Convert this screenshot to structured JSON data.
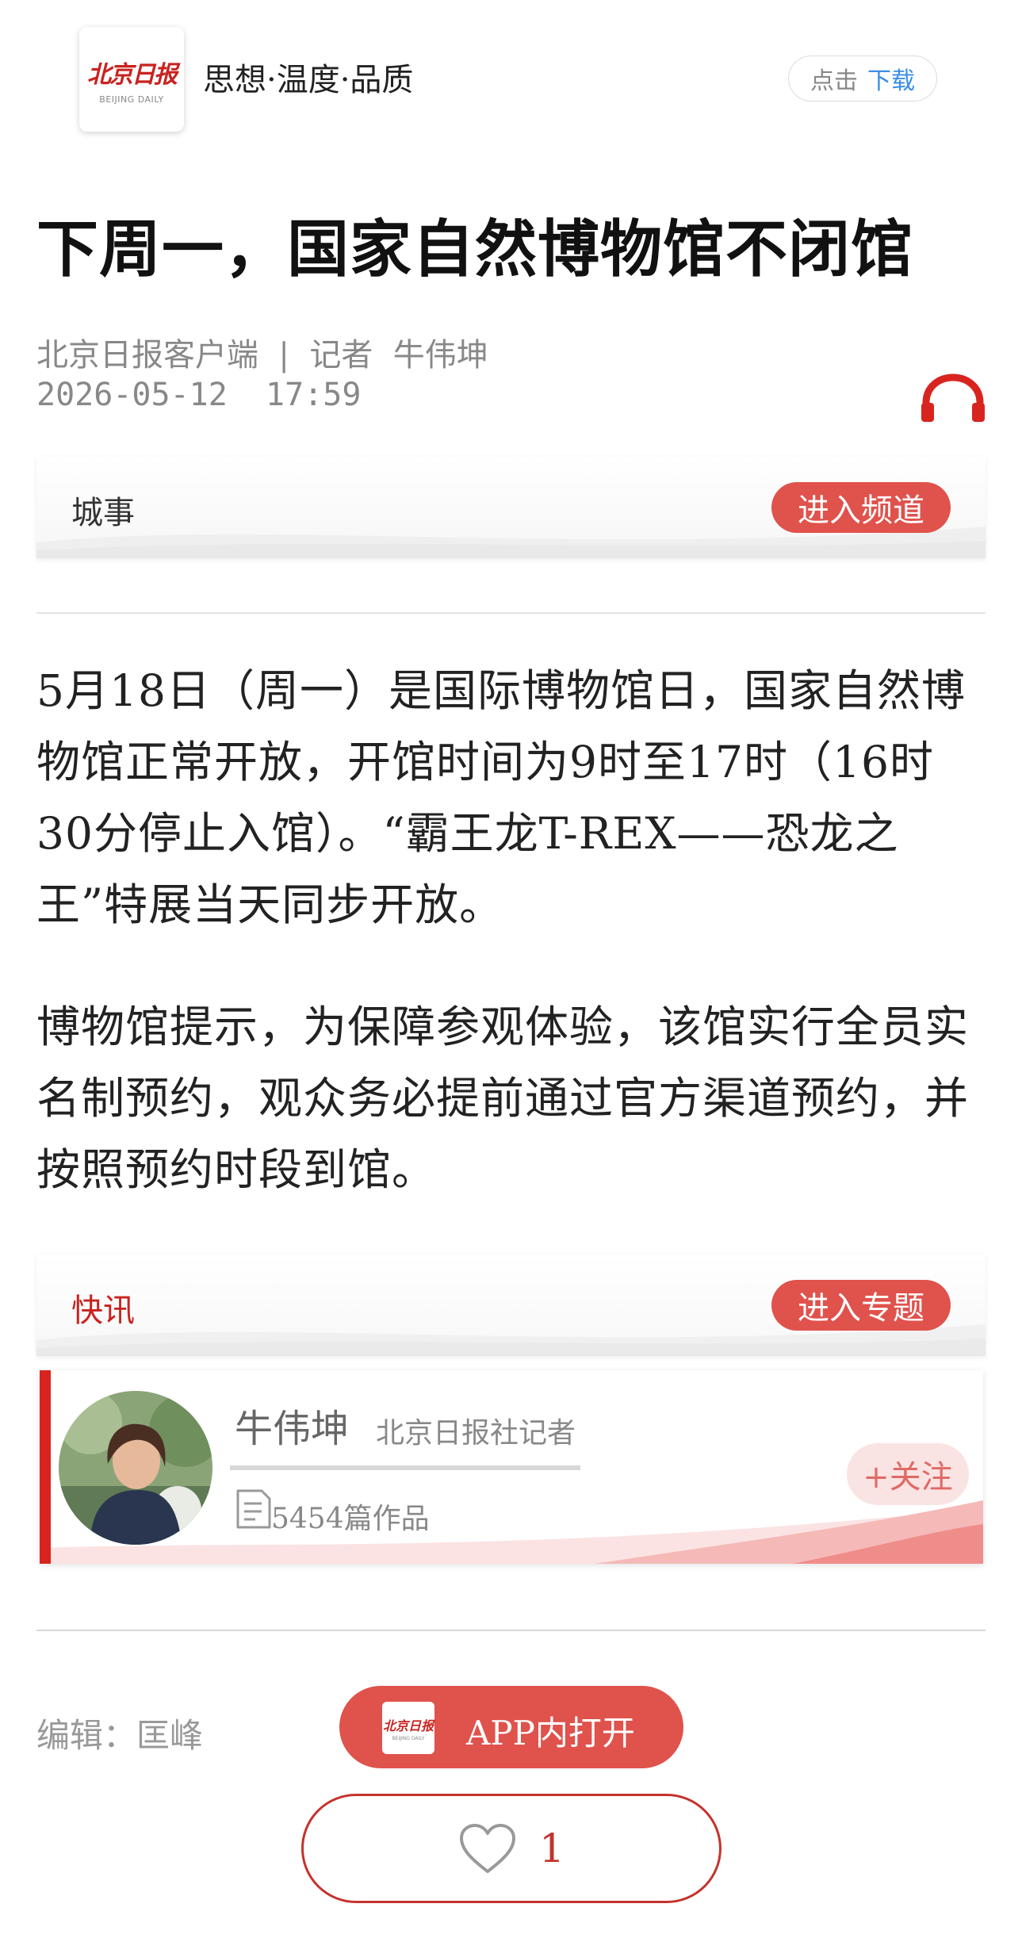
{
  "header": {
    "logo": {
      "cn": "北京日报",
      "en": "BEIJING DAILY"
    },
    "slogan": "思想·温度·品质",
    "download": {
      "prefix": "点击",
      "action": "下载"
    }
  },
  "article": {
    "title": "下周一，国家自然博物馆不闭馆",
    "source": "北京日报客户端  |  记者  牛伟坤",
    "datetime": "2026-05-12  17:59",
    "channel": {
      "label": "城事",
      "button": "进入频道"
    },
    "paragraphs": [
      "5月18日（周一）是国际博物馆日，国家自然博物馆正常开放，开馆时间为9时至17时（16时30分停止入馆）。“霸王龙T-REX——恐龙之王”特展当天同步开放。",
      "博物馆提示，为保障参观体验，该馆实行全员实名制预约，观众务必提前通过官方渠道预约，并按照预约时段到馆。"
    ],
    "topic": {
      "label": "快讯",
      "button": "进入专题"
    }
  },
  "author": {
    "name": "牛伟坤",
    "role": "北京日报社记者",
    "works": "5454篇作品",
    "follow": "+关注"
  },
  "footer": {
    "editor": "编辑：匡峰",
    "open_app": "APP内打开",
    "likes": "1"
  },
  "colors": {
    "brand_red": "#d8241f",
    "pill_red": "#e0524c",
    "link_blue": "#3a8ee6"
  },
  "icons": [
    "headphone-icon",
    "works-icon",
    "heart-icon",
    "logo-icon"
  ]
}
